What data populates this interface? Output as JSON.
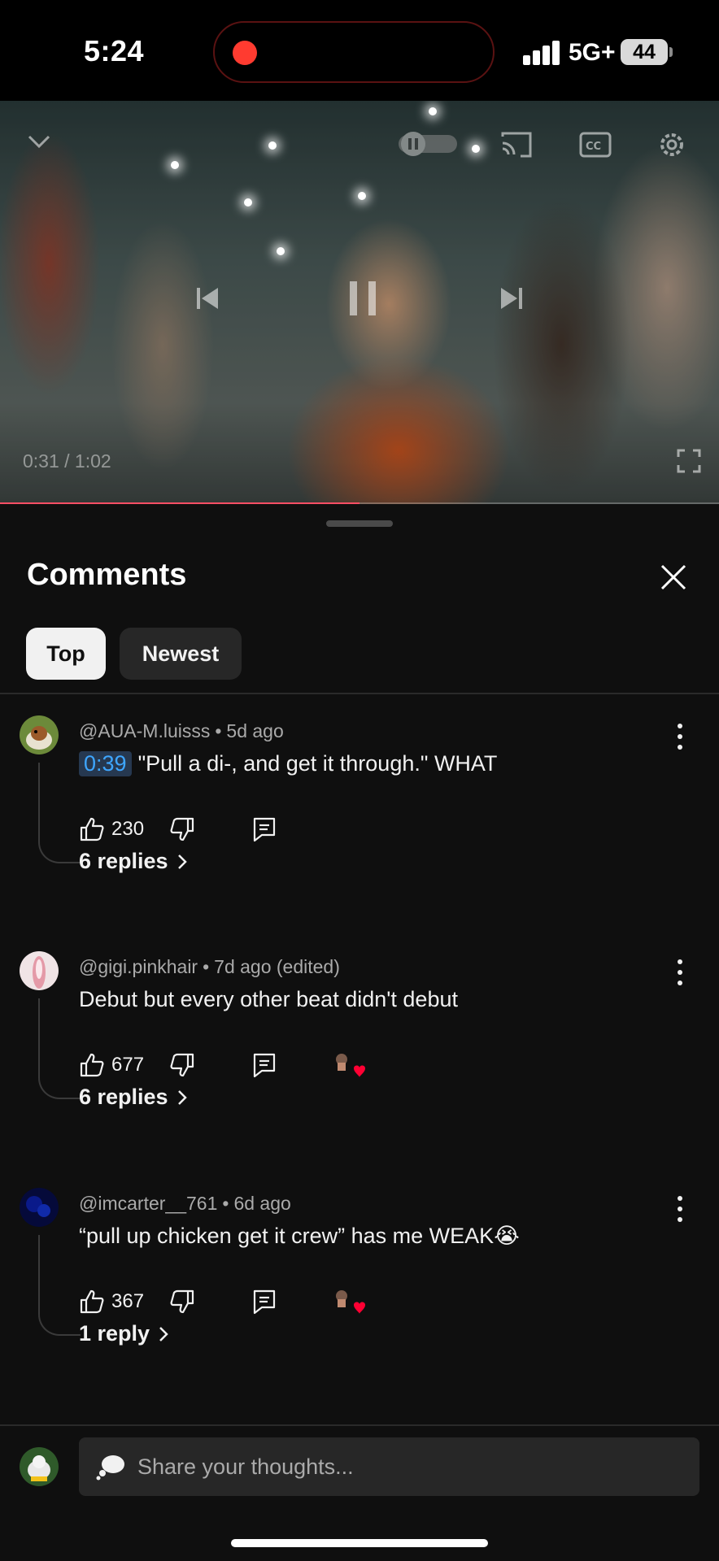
{
  "status_bar": {
    "time": "5:24",
    "network": "5G+",
    "battery": "44"
  },
  "video": {
    "time": "0:31 / 1:02",
    "progress_fraction": 0.5
  },
  "comments_sheet": {
    "title": "Comments",
    "filters": [
      "Top",
      "Newest"
    ],
    "selected_filter": "Top",
    "comments": [
      {
        "author": "@AUA-M.luisss",
        "age": "5d ago",
        "timestamp": "0:39",
        "text": "\"Pull a di-, and get it through.\" WHAT",
        "likes": "230",
        "replies_label": "6 replies"
      },
      {
        "author": "@gigi.pinkhair",
        "age": "7d ago (edited)",
        "text": "Debut but every other beat didn't debut",
        "likes": "677",
        "replies_label": "6 replies"
      },
      {
        "author": "@imcarter__761",
        "age": "6d ago",
        "text": "“pull up chicken get it crew” has me WEAK😭",
        "likes": "367",
        "replies_label": "1 reply"
      }
    ]
  },
  "composer": {
    "placeholder": "Share your thoughts..."
  }
}
